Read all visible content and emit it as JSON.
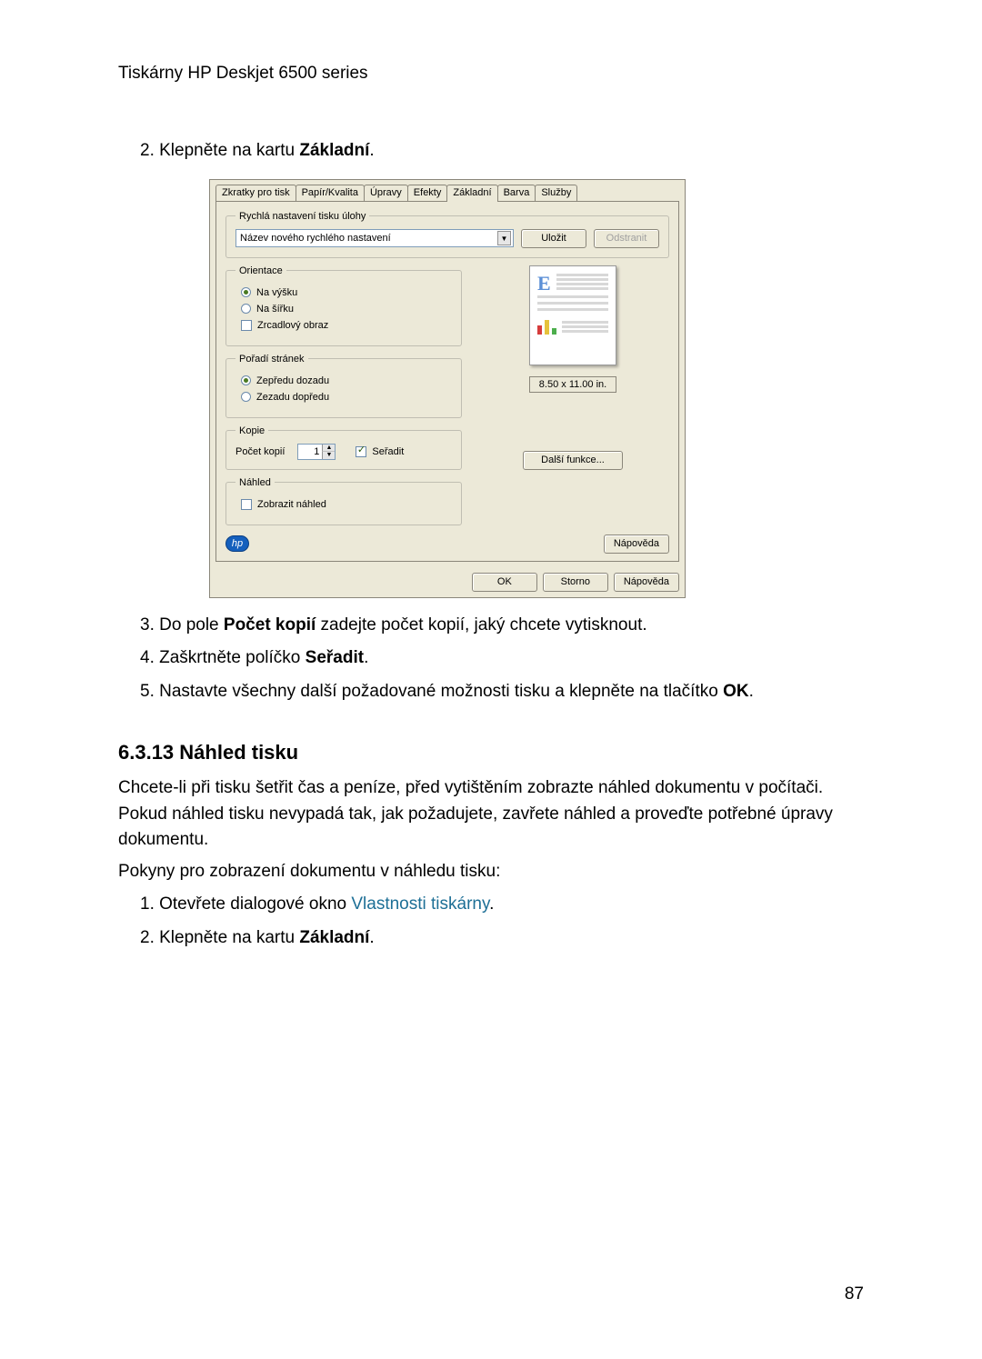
{
  "header": {
    "title": "Tiskárny HP Deskjet 6500 series"
  },
  "steps_a": {
    "s2_pre": "2.  Klepněte na kartu ",
    "s2_bold": "Základní",
    "s2_post": "."
  },
  "dialog": {
    "tabs": [
      "Zkratky pro tisk",
      "Papír/Kvalita",
      "Úpravy",
      "Efekty",
      "Základní",
      "Barva",
      "Služby"
    ],
    "active_tab_index": 4,
    "quicksets": {
      "legend": "Rychlá nastavení tisku úlohy",
      "combo_placeholder": "Název nového rychlého nastavení",
      "save": "Uložit",
      "delete": "Odstranit"
    },
    "orientation": {
      "legend": "Orientace",
      "portrait": "Na výšku",
      "landscape": "Na šířku",
      "mirror": "Zrcadlový obraz"
    },
    "page_order": {
      "legend": "Pořadí stránek",
      "front_to_back": "Zepředu dozadu",
      "back_to_front": "Zezadu dopředu"
    },
    "copies": {
      "legend": "Kopie",
      "count_label": "Počet kopií",
      "count_value": "1",
      "collate": "Seřadit"
    },
    "preview": {
      "legend": "Náhled",
      "show_preview": "Zobrazit náhled"
    },
    "size_label": "8.50 x 11.00 in.",
    "more_features": "Další funkce...",
    "help_inner": "Nápověda",
    "buttons": {
      "ok": "OK",
      "cancel": "Storno",
      "help": "Nápověda"
    },
    "hp_logo": "hp"
  },
  "steps_b": {
    "s3_pre": "3.  Do pole ",
    "s3_bold": "Počet kopií",
    "s3_post": " zadejte počet kopií, jaký chcete vytisknout.",
    "s4_pre": "4.  Zaškrtněte políčko ",
    "s4_bold": "Seřadit",
    "s4_post": ".",
    "s5_pre": "5.  Nastavte všechny další požadované možnosti tisku a klepněte na tlačítko ",
    "s5_bold": "OK",
    "s5_post": "."
  },
  "section": {
    "heading": "6.3.13  Náhled tisku",
    "p1": "Chcete-li při tisku šetřit čas a peníze, před vytištěním zobrazte náhled dokumentu v počítači. Pokud náhled tisku nevypadá tak, jak požadujete, zavřete náhled a proveďte potřebné úpravy dokumentu.",
    "p2": "Pokyny pro zobrazení dokumentu v náhledu tisku:",
    "s1_pre": "1.  Otevřete dialogové okno ",
    "s1_link": "Vlastnosti tiskárny",
    "s1_post": ".",
    "s2_pre": "2.  Klepněte na kartu ",
    "s2_bold": "Základní",
    "s2_post": "."
  },
  "page_number": "87"
}
